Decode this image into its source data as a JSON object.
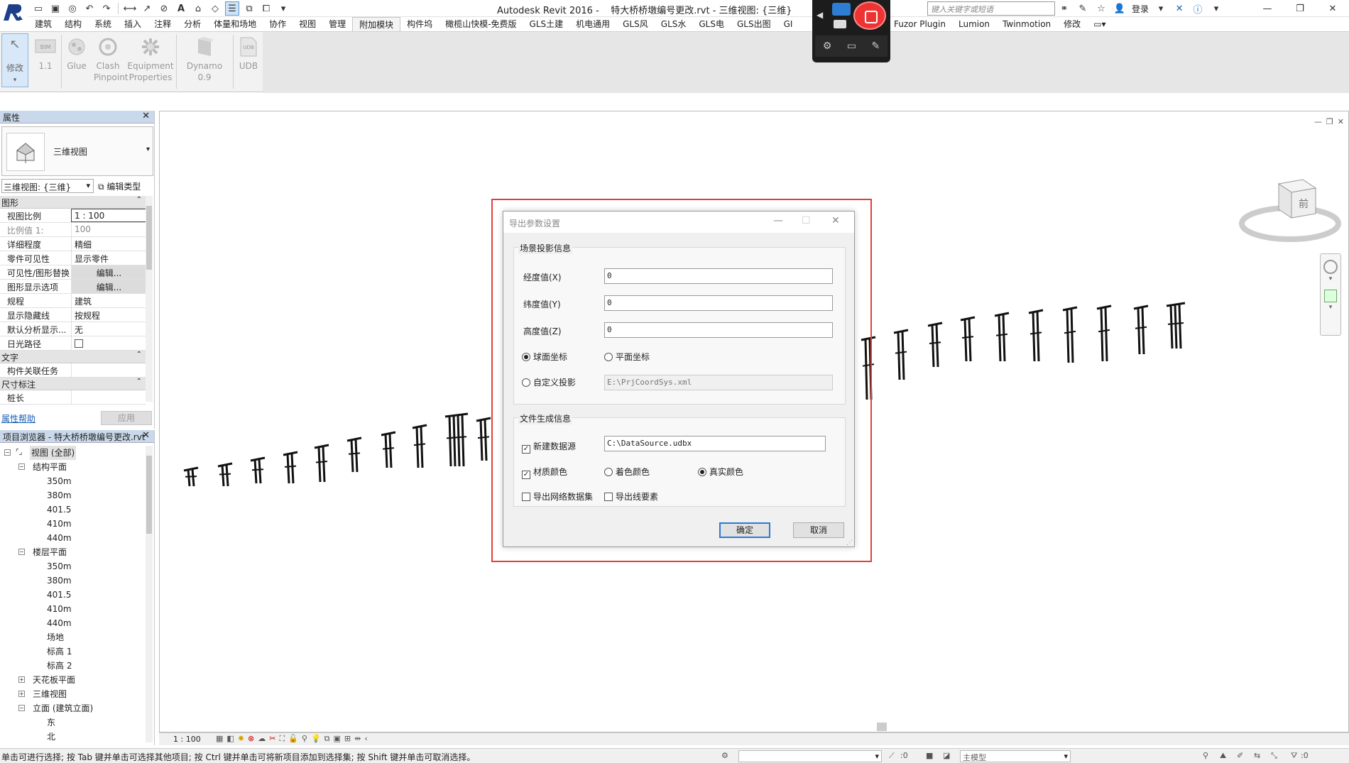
{
  "window": {
    "app": "Autodesk Revit 2016 -",
    "doc": "特大桥桥墩编号更改.rvt - 三维视图: {三维}",
    "search_placeholder": "键入关键字或短语",
    "login": "登录"
  },
  "ribbon": {
    "tabs": [
      "建筑",
      "结构",
      "系统",
      "插入",
      "注释",
      "分析",
      "体量和场地",
      "协作",
      "视图",
      "管理",
      "附加模块",
      "构件坞",
      "橄榄山快模-免费版",
      "GLS土建",
      "机电通用",
      "GLS风",
      "GLS水",
      "GLS电",
      "GLS出图",
      "GI"
    ],
    "tabs_right": [
      "Fuzor Plugin",
      "Lumion",
      "Twinmotion",
      "修改"
    ],
    "active_tab": "附加模块",
    "buttons": {
      "modify": "修改",
      "ibim": "1.1",
      "glue": "Glue",
      "clash_1": "Clash",
      "clash_2": "Pinpoint",
      "equip_1": "Equipment",
      "equip_2": "Properties",
      "dynamo": "Dynamo 0.9",
      "udb": "UDB"
    }
  },
  "properties": {
    "title": "属性",
    "type_name": "三维视图",
    "view_filter": "三维视图: {三维}",
    "edit_type": "编辑类型",
    "sections": {
      "graphics": "图形",
      "text": "文字",
      "dimension": "尺寸标注"
    },
    "rows": [
      {
        "k": "视图比例",
        "v": "1 : 100"
      },
      {
        "k": "比例值 1:",
        "v": "100"
      },
      {
        "k": "详细程度",
        "v": "精细"
      },
      {
        "k": "零件可见性",
        "v": "显示零件"
      },
      {
        "k": "可见性/图形替换",
        "v": "编辑..."
      },
      {
        "k": "图形显示选项",
        "v": "编辑..."
      },
      {
        "k": "规程",
        "v": "建筑"
      },
      {
        "k": "显示隐藏线",
        "v": "按规程"
      },
      {
        "k": "默认分析显示...",
        "v": "无"
      },
      {
        "k": "日光路径",
        "v": ""
      },
      {
        "k": "构件关联任务",
        "v": ""
      },
      {
        "k": "桩长",
        "v": ""
      }
    ],
    "help": "属性帮助",
    "apply": "应用"
  },
  "browser": {
    "title": "项目浏览器 - 特大桥桥墩编号更改.rvt",
    "nodes": [
      "视图 (全部)",
      "结构平面",
      "350m",
      "380m",
      "401.5",
      "410m",
      "440m",
      "楼层平面",
      "350m",
      "380m",
      "401.5",
      "410m",
      "440m",
      "场地",
      "标高 1",
      "标高 2",
      "天花板平面",
      "三维视图",
      "立面 (建筑立面)",
      "东",
      "北"
    ]
  },
  "viewcube": {
    "face": "前"
  },
  "dialog": {
    "title": "导出参数设置",
    "group1": "场景投影信息",
    "lon_label": "经度值(X)",
    "lat_label": "纬度值(Y)",
    "alt_label": "高度值(Z)",
    "lon": "0",
    "lat": "0",
    "alt": "0",
    "radio_sphere": "球面坐标",
    "radio_plane": "平面坐标",
    "radio_custom": "自定义投影",
    "custom_path": "E:\\PrjCoordSys.xml",
    "group2": "文件生成信息",
    "new_ds": "新建数据源",
    "ds_path": "C:\\DataSource.udbx",
    "material_color": "材质颜色",
    "shade_color": "着色颜色",
    "real_color": "真实颜色",
    "export_mesh": "导出网络数据集",
    "export_line": "导出线要素",
    "ok": "确定",
    "cancel": "取消"
  },
  "view_status": {
    "scale": "1 : 100"
  },
  "status": {
    "message": "单击可进行选择; 按 Tab 键并单击可选择其他项目; 按 Ctrl 键并单击可将新项目添加到选择集; 按 Shift 键并单击可取消选择。",
    "coord": ":0",
    "model": "主模型",
    "filter_count": ":0"
  }
}
